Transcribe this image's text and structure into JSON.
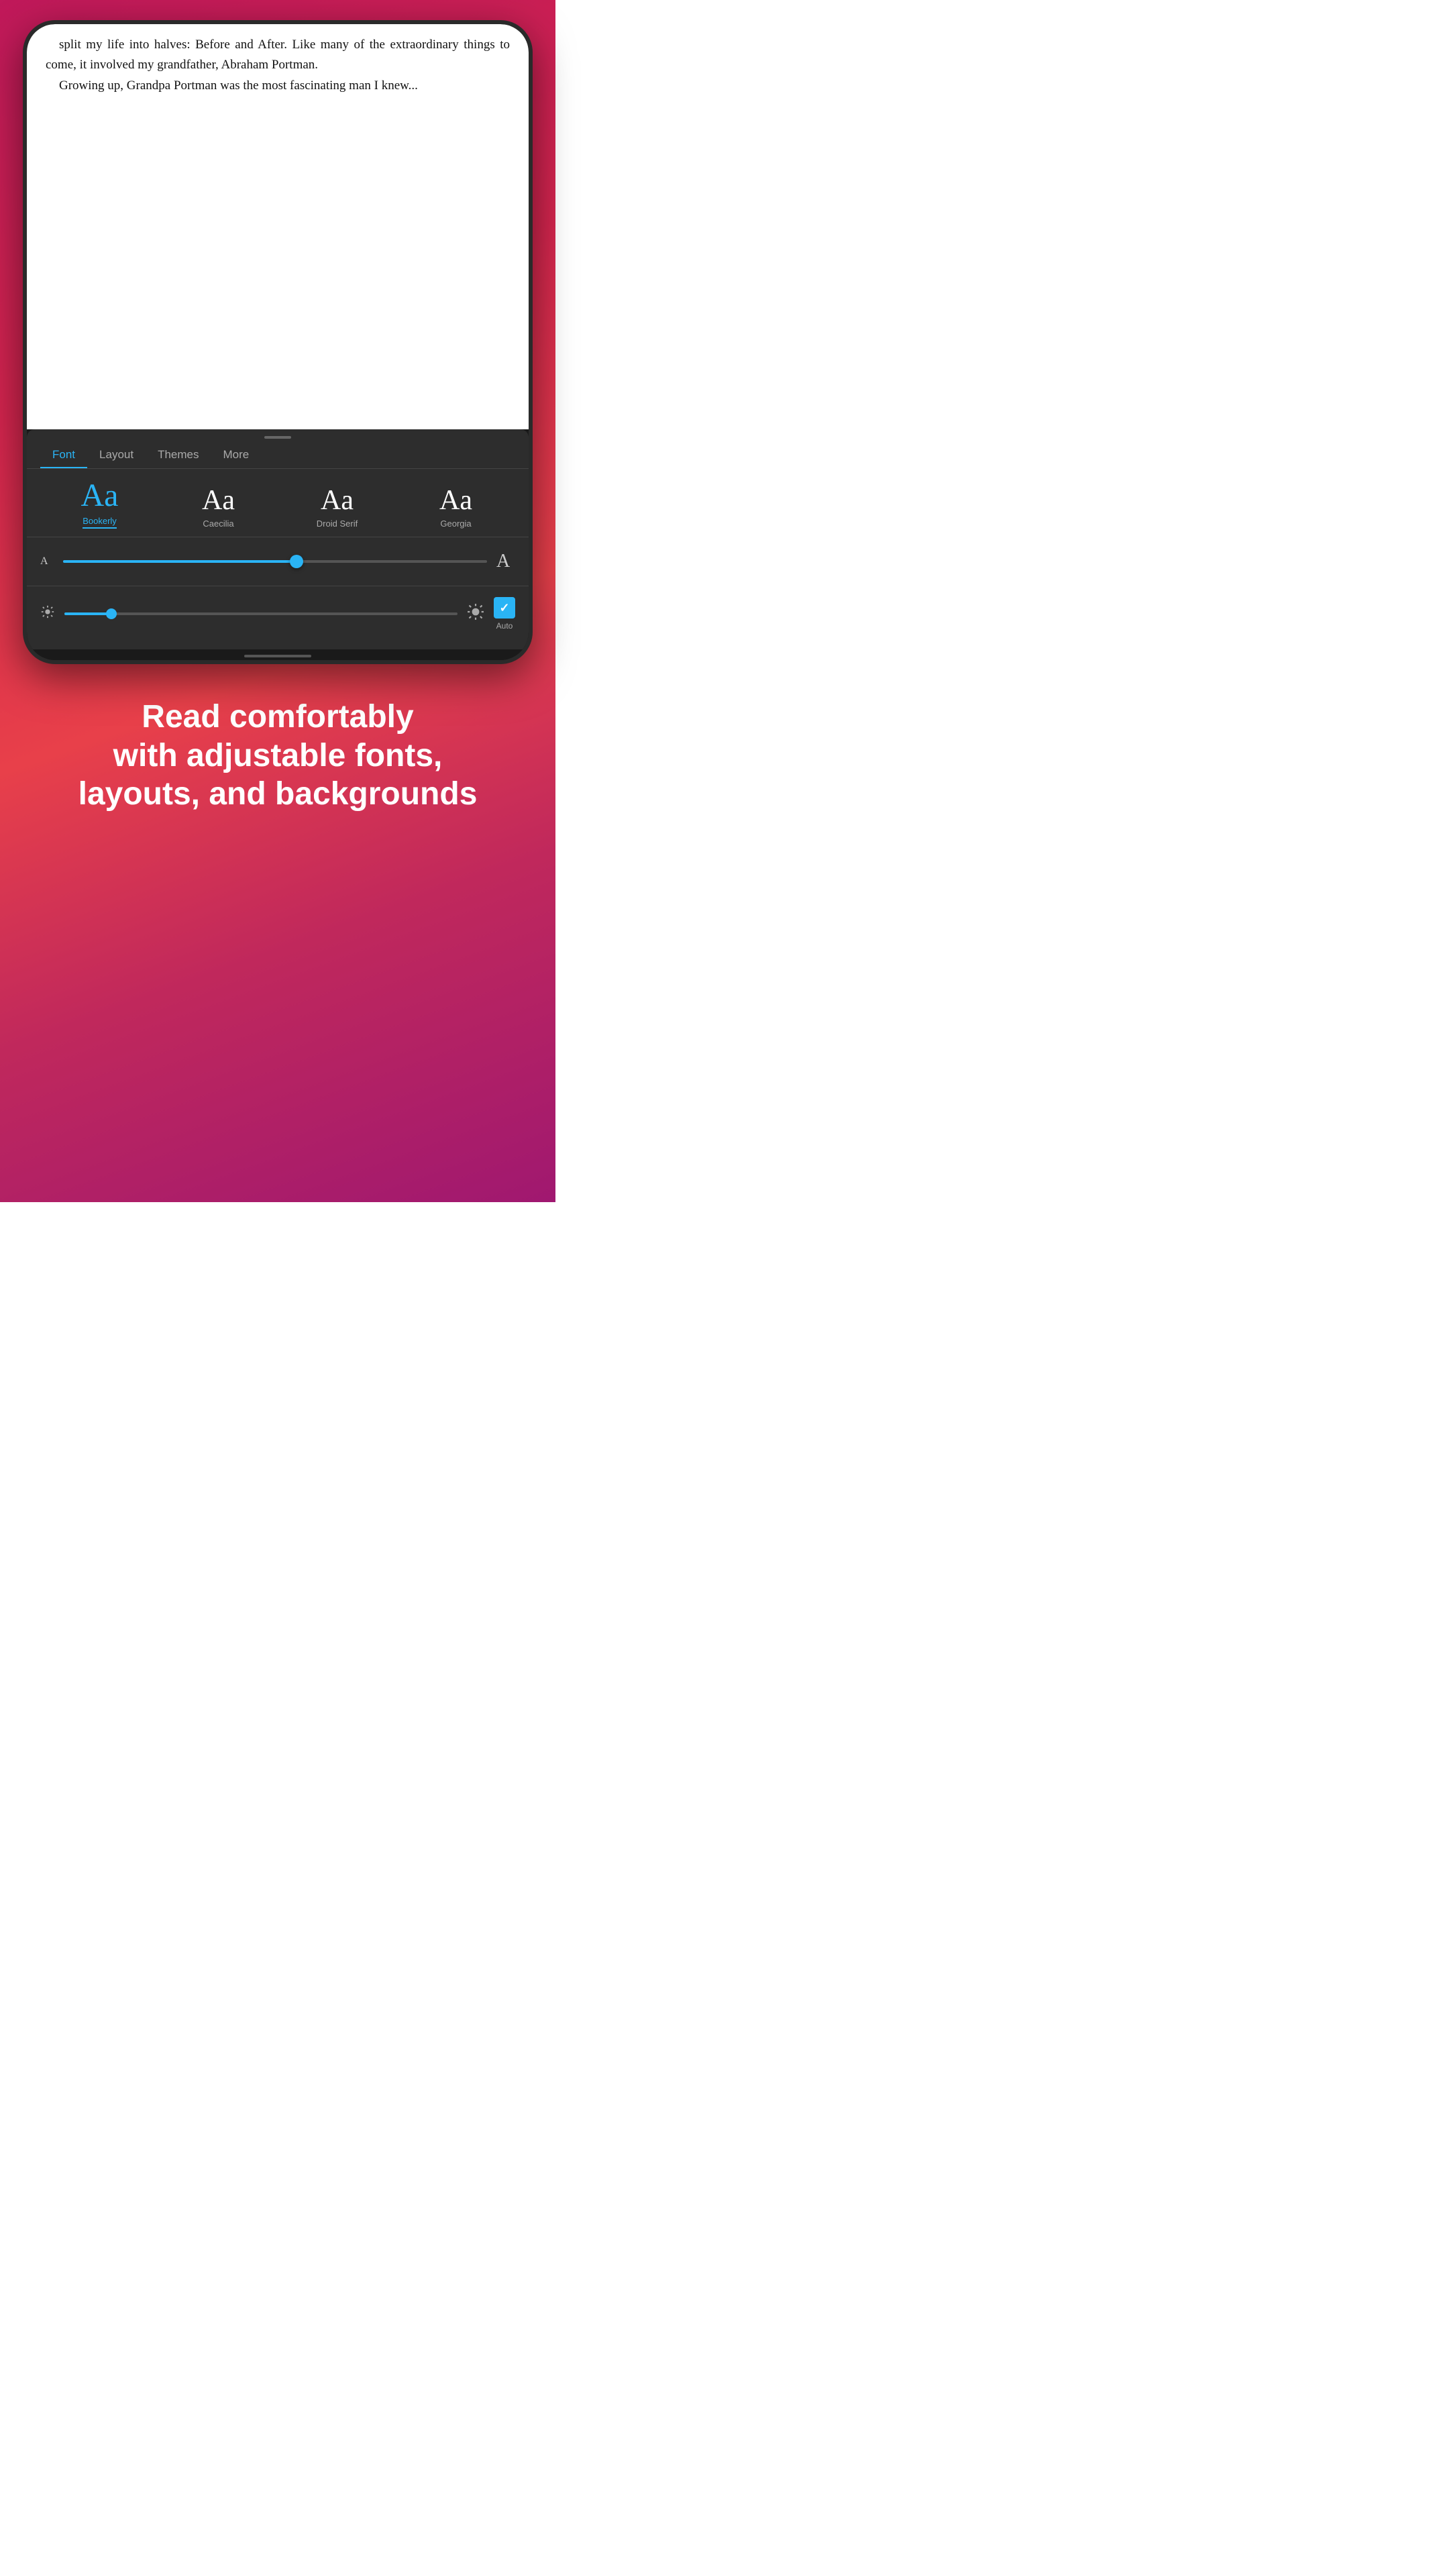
{
  "background": {
    "gradient_start": "#c0195a",
    "gradient_end": "#a01870"
  },
  "book": {
    "text": "split my life into halves: Before and After. Like many of the extraordinary things to come, it involved my grandfather, Abraham Portman.",
    "text2": "Growing up, Grandpa Portman was the most fascinating man I knew..."
  },
  "tabs": {
    "items": [
      {
        "label": "Font",
        "active": true
      },
      {
        "label": "Layout",
        "active": false
      },
      {
        "label": "Themes",
        "active": false
      },
      {
        "label": "More",
        "active": false
      }
    ]
  },
  "fonts": [
    {
      "sample": "Aa",
      "name": "Bookerly",
      "active": true
    },
    {
      "sample": "Aa",
      "name": "Caecilia",
      "active": false
    },
    {
      "sample": "Aa",
      "name": "Droid Serif",
      "active": false
    },
    {
      "sample": "Aa",
      "name": "Georgia",
      "active": false
    }
  ],
  "size_slider": {
    "small_label": "A",
    "large_label": "A",
    "fill_percent": 55
  },
  "brightness_slider": {
    "fill_percent": 12,
    "auto_label": "Auto"
  },
  "tagline": {
    "line1": "Read comfortably",
    "line2": "with adjustable fonts,",
    "line3": "layouts, and backgrounds"
  }
}
